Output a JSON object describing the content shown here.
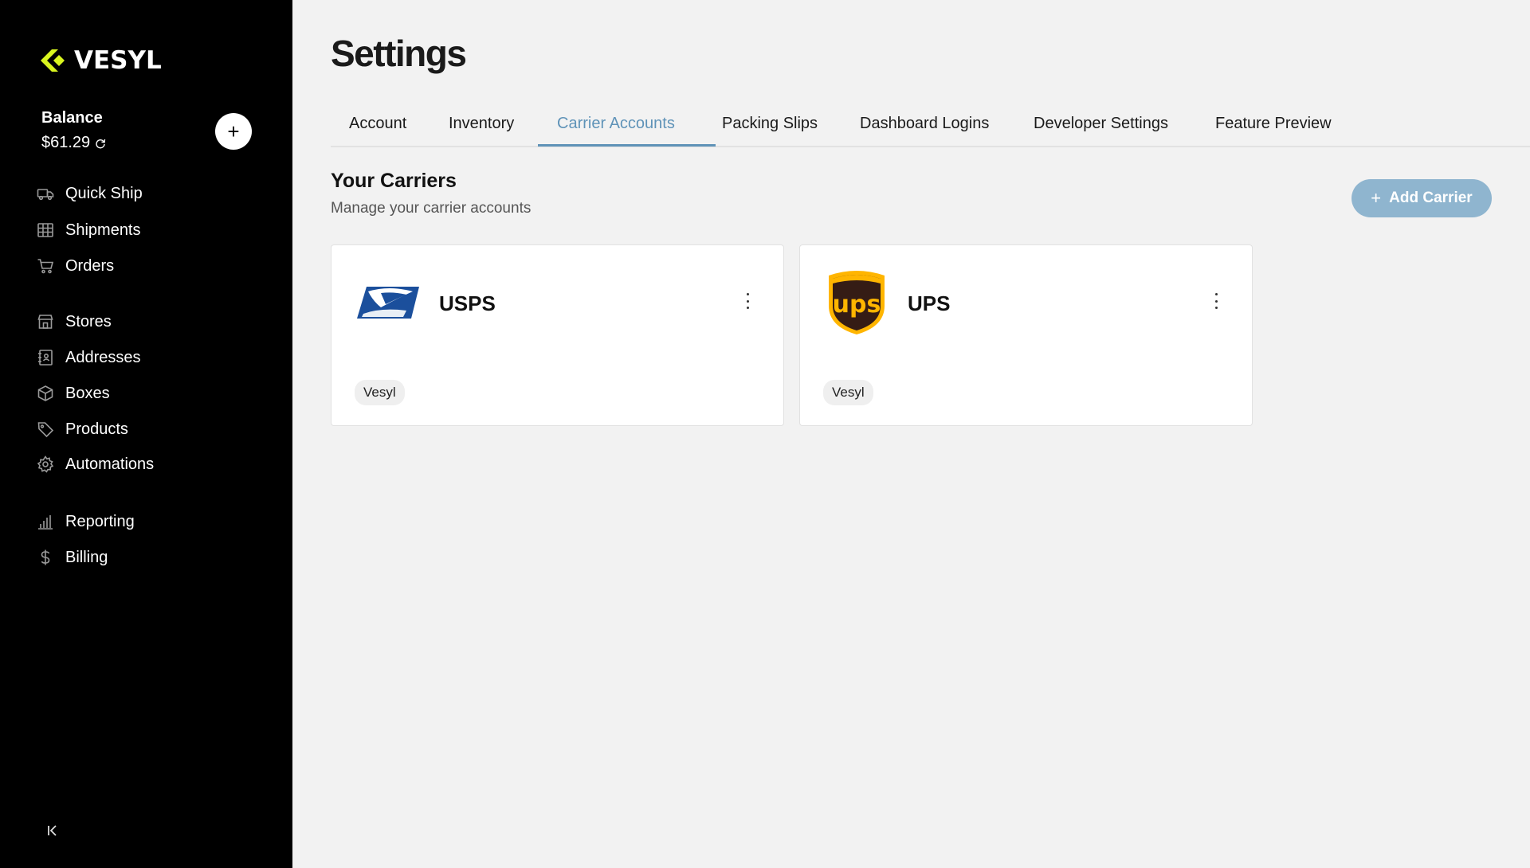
{
  "brand": {
    "name": "VESYL",
    "accent": "#d9f51f"
  },
  "sidebar": {
    "balance_label": "Balance",
    "balance_value": "$61.29",
    "add_label": "+",
    "groups": [
      [
        {
          "label": "Quick Ship",
          "icon": "truck-icon"
        },
        {
          "label": "Shipments",
          "icon": "grid-icon"
        },
        {
          "label": "Orders",
          "icon": "cart-icon"
        }
      ],
      [
        {
          "label": "Stores",
          "icon": "store-icon"
        },
        {
          "label": "Addresses",
          "icon": "address-book-icon"
        },
        {
          "label": "Boxes",
          "icon": "box-icon"
        },
        {
          "label": "Products",
          "icon": "tag-icon"
        },
        {
          "label": "Automations",
          "icon": "gear-icon"
        }
      ],
      [
        {
          "label": "Reporting",
          "icon": "bar-chart-icon"
        },
        {
          "label": "Billing",
          "icon": "dollar-icon"
        }
      ]
    ],
    "collapse_label": "K"
  },
  "page": {
    "title": "Settings"
  },
  "tabs": [
    {
      "label": "Account",
      "active": false
    },
    {
      "label": "Inventory",
      "active": false
    },
    {
      "label": "Carrier Accounts",
      "active": true
    },
    {
      "label": "Packing Slips",
      "active": false
    },
    {
      "label": "Dashboard Logins",
      "active": false
    },
    {
      "label": "Developer Settings",
      "active": false
    },
    {
      "label": "Feature Preview",
      "active": false
    }
  ],
  "carriers_section": {
    "title": "Your Carriers",
    "subtitle": "Manage your carrier accounts",
    "add_button": "Add Carrier"
  },
  "carriers": [
    {
      "name": "USPS",
      "badge": "Vesyl",
      "logo": "usps-eagle-logo"
    },
    {
      "name": "UPS",
      "badge": "Vesyl",
      "logo": "ups-shield-logo"
    }
  ],
  "colors": {
    "active_tab": "#5f93b8",
    "add_button_bg": "#8fb5cf",
    "sidebar_bg": "#000000"
  }
}
